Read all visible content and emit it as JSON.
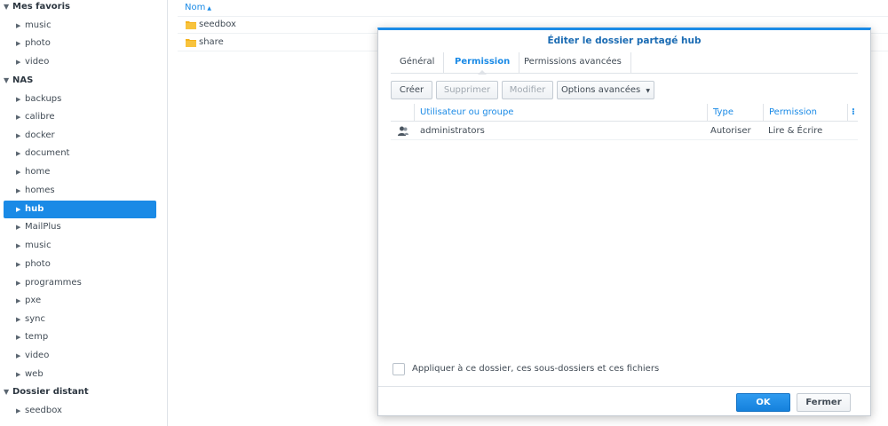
{
  "sidebar": {
    "favorites": {
      "title": "Mes favoris",
      "items": [
        "music",
        "photo",
        "video"
      ]
    },
    "nas": {
      "title": "NAS",
      "items": [
        "backups",
        "calibre",
        "docker",
        "document",
        "home",
        "homes",
        "hub",
        "MailPlus",
        "music",
        "photo",
        "programmes",
        "pxe",
        "sync",
        "temp",
        "video",
        "web"
      ],
      "selected": "hub"
    },
    "remote": {
      "title": "Dossier distant",
      "items": [
        "seedbox"
      ]
    }
  },
  "filelist": {
    "column_name": "Nom",
    "files": [
      "seedbox",
      "share"
    ]
  },
  "dialog": {
    "title": "Éditer le dossier partagé hub",
    "tabs": [
      "Général",
      "Permission",
      "Permissions avancées"
    ],
    "active_tab": "Permission",
    "toolbar": {
      "create": "Créer",
      "delete": "Supprimer",
      "modify": "Modifier",
      "advanced_options": "Options avancées"
    },
    "grid": {
      "columns": [
        "Utilisateur ou groupe",
        "Type",
        "Permission"
      ],
      "rows": [
        {
          "user": "administrators",
          "type": "Autoriser",
          "permission": "Lire & Écrire"
        }
      ]
    },
    "apply_label": "Appliquer à ce dossier, ces sous-dossiers et ces fichiers",
    "ok_label": "OK",
    "close_label": "Fermer"
  },
  "colors": {
    "accent": "#1a8ae6",
    "folder": "#f5b21b"
  }
}
